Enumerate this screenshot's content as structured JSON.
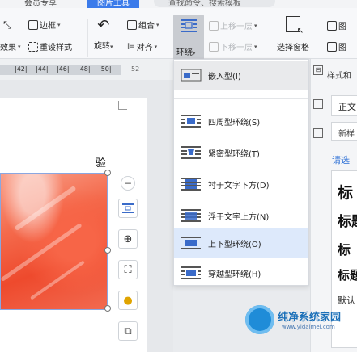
{
  "colors": {
    "accent": "#3b7bea",
    "menu_highlight": "#e9eaec",
    "menu_selected": "#dde9fb",
    "link": "#2b6fd6",
    "painting": "#ee4a2d"
  },
  "top_tabs": {
    "tab_left": "会员专享",
    "tab_active": "图片工具",
    "search": "查找命令、搜索模板"
  },
  "ribbon": {
    "border": "边框",
    "reset_style": "重设样式",
    "crop_partial": "裁",
    "effect_partial": "效果",
    "rotate": "旋转",
    "group": "组合",
    "align": "对齐",
    "wrap": "环绕",
    "bring_forward": "上移一层",
    "send_backward": "下移一层",
    "selection_pane": "选择窗格",
    "right_partial_1": "图",
    "right_partial_2": "图"
  },
  "ruler": {
    "marks": [
      "|42|",
      "|44|",
      "|46|",
      "|48|",
      "|50|"
    ],
    "end_mark": "52"
  },
  "document": {
    "char": "验"
  },
  "float_tools": {
    "minus": "−"
  },
  "wrap_menu": {
    "items": [
      {
        "label": "嵌入型(I)",
        "state": "highlighted",
        "icon": "inline-wrap-icon"
      },
      {
        "label": "四周型环绕(S)",
        "state": "normal",
        "icon": "square-wrap-icon"
      },
      {
        "label": "紧密型环绕(T)",
        "state": "normal",
        "icon": "tight-wrap-icon"
      },
      {
        "label": "衬于文字下方(D)",
        "state": "normal",
        "icon": "behind-text-icon"
      },
      {
        "label": "浮于文字上方(N)",
        "state": "normal",
        "icon": "in-front-of-text-icon"
      },
      {
        "label": "上下型环绕(O)",
        "state": "selected",
        "icon": "top-bottom-wrap-icon"
      },
      {
        "label": "穿越型环绕(H)",
        "state": "normal",
        "icon": "through-wrap-icon"
      }
    ]
  },
  "right_panel": {
    "header": "样式和",
    "body_style": "正文",
    "new_style": "新样",
    "select_link": "请选",
    "headings": [
      "标",
      "标题",
      "标",
      "标题"
    ],
    "default_label": "默认"
  },
  "watermark": {
    "title": "纯净系统家园",
    "url": "www.yidaimei.com"
  }
}
